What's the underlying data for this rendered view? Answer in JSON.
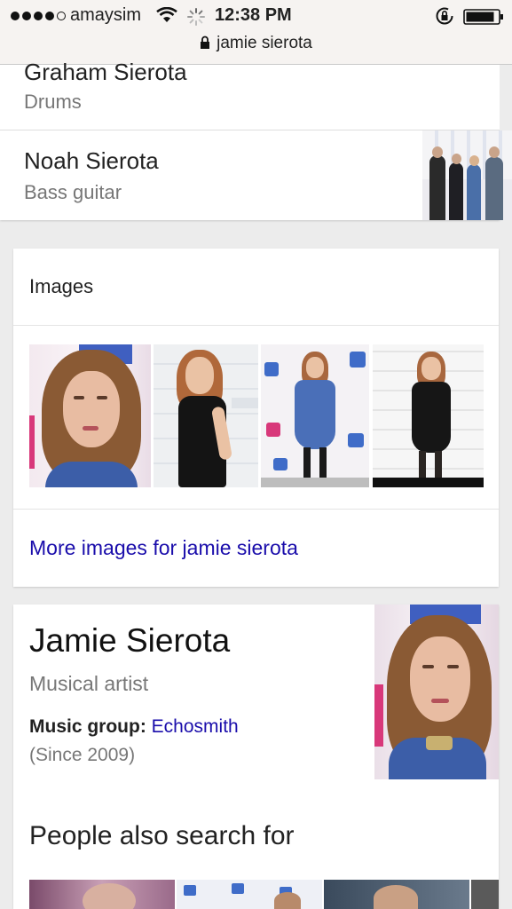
{
  "status_bar": {
    "carrier": "amaysim",
    "time": "12:38 PM",
    "url": "jamie sierota",
    "icons": [
      "signal-dots-icon",
      "wifi-icon",
      "loading-spinner-icon",
      "rotation-lock-icon",
      "battery-icon",
      "lock-icon"
    ]
  },
  "members": [
    {
      "name": "Graham Sierota",
      "role": "Drums"
    },
    {
      "name": "Noah Sierota",
      "role": "Bass guitar"
    }
  ],
  "images_card": {
    "title": "Images",
    "more_link": "More images for jamie sierota"
  },
  "knowledge_panel": {
    "name": "Jamie Sierota",
    "subtitle": "Musical artist",
    "music_group_label": "Music group:",
    "music_group_value": "Echosmith",
    "since": "(Since 2009)",
    "people_also_search": "People also search for"
  },
  "colors": {
    "link": "#1a0dab",
    "background": "#ececec",
    "card": "#ffffff",
    "secondary_text": "#777777"
  }
}
